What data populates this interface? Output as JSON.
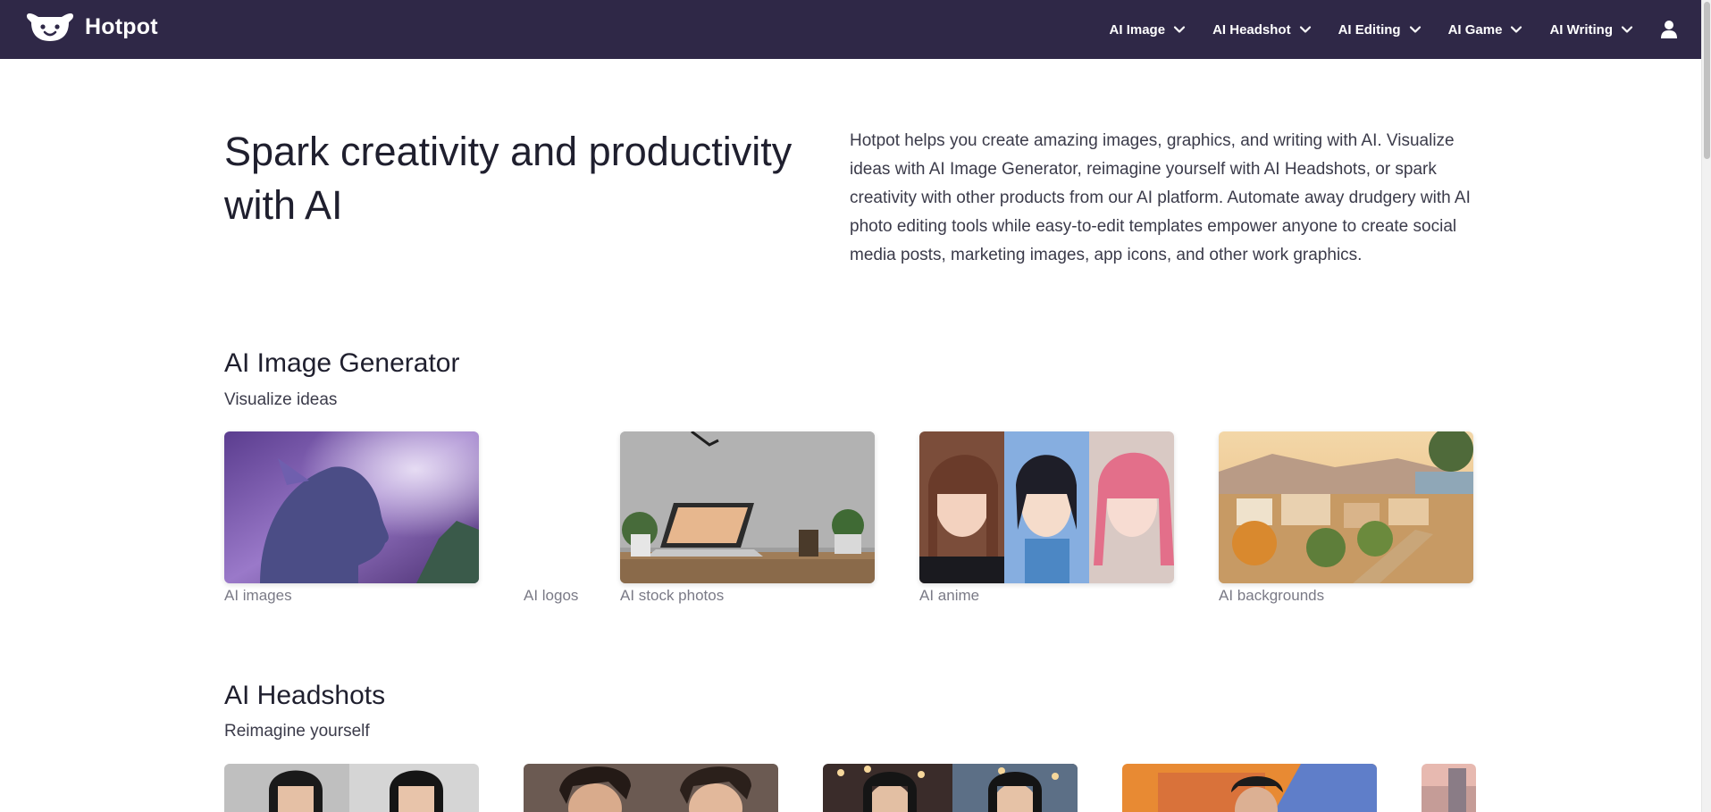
{
  "header": {
    "logo_text": "Hotpot",
    "logo_icon": "bear-face-icon",
    "nav": [
      {
        "label": "AI Image"
      },
      {
        "label": "AI Headshot"
      },
      {
        "label": "AI Editing"
      },
      {
        "label": "AI Game"
      },
      {
        "label": "AI Writing"
      }
    ],
    "user_icon": "user-icon",
    "background_color": "#2f2847"
  },
  "hero": {
    "title": "Spark creativity and productivity with AI",
    "description": "Hotpot helps you create amazing images, graphics, and writing with AI. Visualize ideas with AI Image Generator, reimagine yourself with AI Headshots, or spark creativity with other products from our AI platform. Automate away drudgery with AI photo editing tools while easy-to-edit templates empower anyone to create social media posts, marketing images, app icons, and other work graphics."
  },
  "sections": [
    {
      "title": "AI Image Generator",
      "subtitle": "Visualize ideas",
      "cards": [
        {
          "label": "AI images"
        },
        {
          "label": "AI logos"
        },
        {
          "label": "AI stock photos"
        },
        {
          "label": "AI anime"
        },
        {
          "label": "AI backgrounds"
        }
      ]
    },
    {
      "title": "AI Headshots",
      "subtitle": "Reimagine yourself"
    }
  ]
}
